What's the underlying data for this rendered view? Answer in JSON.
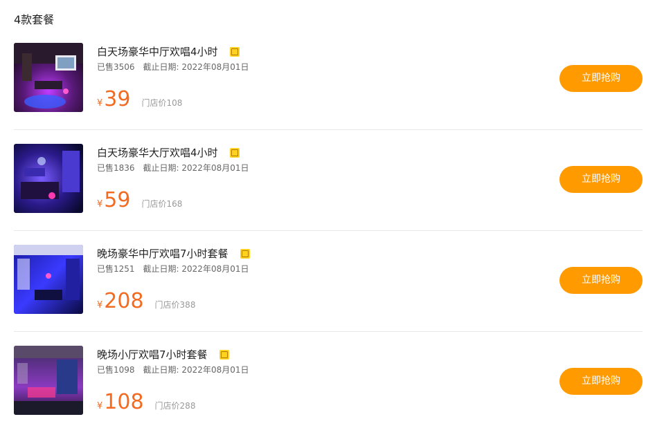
{
  "section_title": "4款套餐",
  "buy_label": "立即抢购",
  "tuan_badge": "团",
  "colors": {
    "accent_price": "#f36b21",
    "button_bg": "#ff9a00",
    "badge_bg": "#ffd21f"
  },
  "packages": [
    {
      "name": "白天场豪华中厅欢唱4小时",
      "sold": "已售3506",
      "deadline": "截止日期: 2022年08月01日",
      "currency": "¥",
      "price": "39",
      "store_price": "门店价108"
    },
    {
      "name": "白天场豪华大厅欢唱4小时",
      "sold": "已售1836",
      "deadline": "截止日期: 2022年08月01日",
      "currency": "¥",
      "price": "59",
      "store_price": "门店价168"
    },
    {
      "name": "晚场豪华中厅欢唱7小时套餐",
      "sold": "已售1251",
      "deadline": "截止日期: 2022年08月01日",
      "currency": "¥",
      "price": "208",
      "store_price": "门店价388"
    },
    {
      "name": "晚场小厅欢唱7小时套餐",
      "sold": "已售1098",
      "deadline": "截止日期: 2022年08月01日",
      "currency": "¥",
      "price": "108",
      "store_price": "门店价288"
    }
  ]
}
